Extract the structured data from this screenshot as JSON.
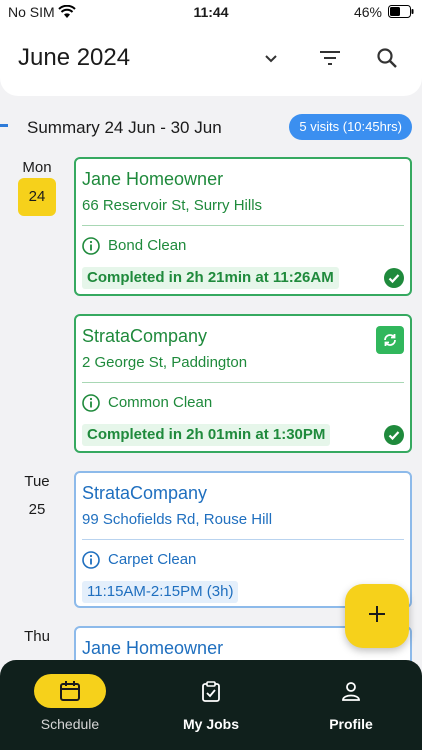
{
  "status_bar": {
    "carrier": "No SIM",
    "time": "11:44",
    "battery": "46%"
  },
  "header": {
    "month": "June 2024"
  },
  "summary": {
    "title": "Summary 24 Jun - 30 Jun",
    "badge": "5 visits (10:45hrs)"
  },
  "days": [
    {
      "weekday": "Mon",
      "date": "24"
    },
    {
      "weekday": "Tue",
      "date": "25"
    },
    {
      "weekday": "Thu"
    }
  ],
  "visits": [
    {
      "client": "Jane Homeowner",
      "address": "66 Reservoir St, Surry Hills",
      "service": "Bond Clean",
      "status": "Completed in 2h 21min at 11:26AM"
    },
    {
      "client": "StrataCompany",
      "address": "2 George St, Paddington",
      "service": "Common Clean",
      "status": "Completed in 2h 01min at 1:30PM"
    },
    {
      "client": "StrataCompany",
      "address": "99 Schofields Rd, Rouse Hill",
      "service": "Carpet Clean",
      "status": "11:15AM-2:15PM (3h)"
    },
    {
      "client": "Jane Homeowner"
    }
  ],
  "nav": {
    "schedule": "Schedule",
    "jobs": "My Jobs",
    "profile": "Profile"
  },
  "colors": {
    "accent": "#f6d11b",
    "complete": "#36a960",
    "scheduled": "#3b8ff0",
    "nav_bg": "#10201c"
  }
}
